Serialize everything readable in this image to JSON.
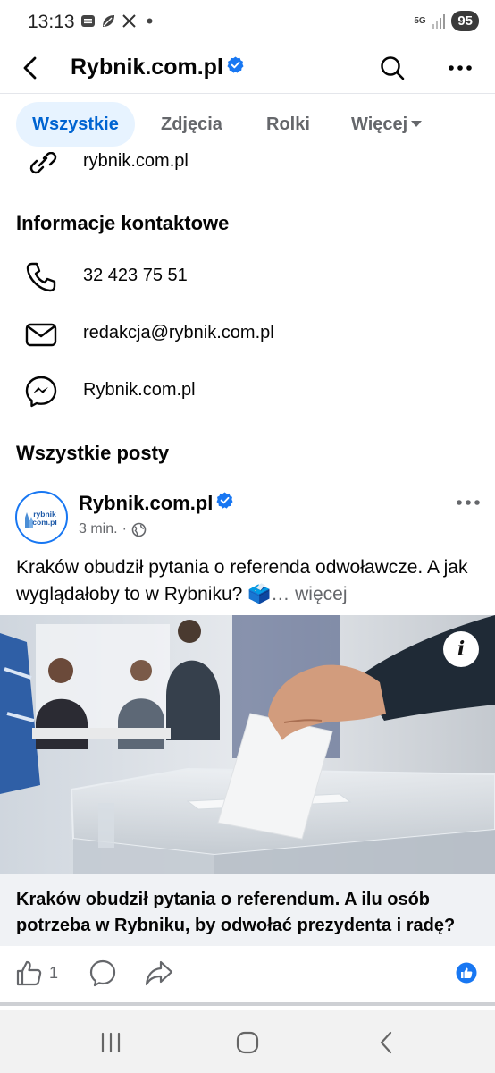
{
  "status_bar": {
    "time": "13:13",
    "network": "5G",
    "battery": "95"
  },
  "header": {
    "title": "Rybnik.com.pl"
  },
  "tabs": [
    {
      "label": "Wszystkie"
    },
    {
      "label": "Zdjęcia"
    },
    {
      "label": "Rolki"
    },
    {
      "label": "Więcej"
    }
  ],
  "website": "rybnik.com.pl",
  "contact": {
    "title": "Informacje kontaktowe",
    "phone": "32 423 75 51",
    "email": "redakcja@rybnik.com.pl",
    "messenger": "Rybnik.com.pl"
  },
  "posts_title": "Wszystkie posty",
  "post": {
    "author": "Rybnik.com.pl",
    "time": "3 min.",
    "text": "Kraków obudził pytania o referenda odwoławcze. A jak wyglądałoby to w Rybniku? 🗳️",
    "more_link": "… więcej",
    "avatar_text_line1": "rybnik",
    "avatar_text_line2": "com.pl",
    "link_title": "Kraków obudził pytania o referendum. A ilu osób potrzeba w Rybniku, by odwołać prezydenta i radę?",
    "like_count": "1"
  },
  "icons": {
    "back": "back-arrow-icon",
    "search": "search-icon",
    "more": "more-horizontal-icon",
    "phone": "phone-icon",
    "email": "envelope-icon",
    "messenger": "messenger-icon",
    "like": "thumbs-up-icon",
    "comment": "comment-icon",
    "share": "share-icon"
  },
  "colors": {
    "accent": "#1877f2",
    "tab_active_bg": "#e7f3ff",
    "tab_active_text": "#0064d1",
    "muted": "#65676b"
  }
}
